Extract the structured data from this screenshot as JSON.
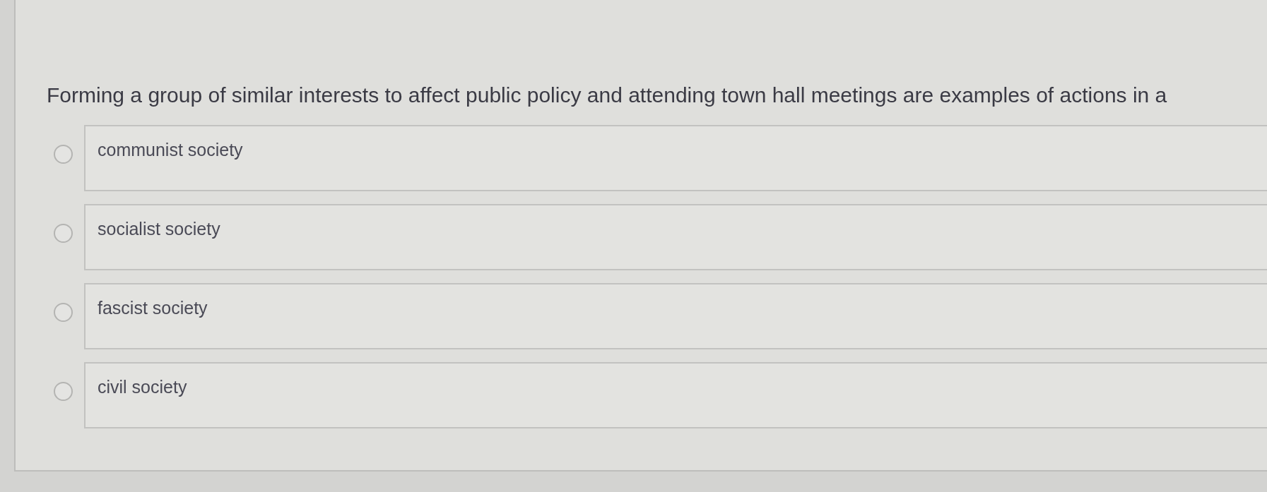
{
  "question": {
    "text": "Forming a group of similar interests to affect public policy and attending town hall meetings are examples of actions in a"
  },
  "options": [
    {
      "label": "communist society",
      "selected": false
    },
    {
      "label": "socialist society",
      "selected": false
    },
    {
      "label": "fascist society",
      "selected": false
    },
    {
      "label": "civil society",
      "selected": false
    }
  ]
}
